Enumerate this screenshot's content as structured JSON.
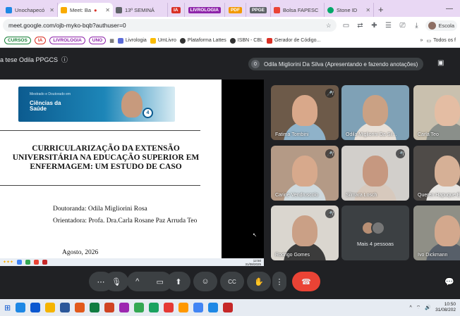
{
  "tabs": [
    {
      "label": "Unochapecó",
      "color": "#1e88e5",
      "icon": "uno-icon",
      "active": false
    },
    {
      "label": "Meet: Ba",
      "color": "#f9ab00",
      "icon": "meet-icon",
      "active": true
    },
    {
      "label": "13º SEMINÁ",
      "color": "#5f6368",
      "icon": "page-icon",
      "active": false
    }
  ],
  "tab_badges": [
    {
      "label": "IA",
      "color": "#d93025"
    },
    {
      "label": "LIVROLOGIA",
      "color": "#8e24aa"
    },
    {
      "label": "PDF",
      "color": "#f29900"
    },
    {
      "label": "PPGE",
      "color": "#5f6368"
    }
  ],
  "tab_bolsa": "Bolsa FAPESC",
  "tab_stone": "Stone ID",
  "window": {
    "minimize": "—",
    "maximize": "☐",
    "close": "✕",
    "newtab": "+"
  },
  "address": {
    "url": "meet.google.com/ojb-myko-bqb?authuser=0",
    "profile": "Escola"
  },
  "bookmarks": {
    "pills": [
      "CURSOS",
      "IA",
      "LIVROLOGIA",
      "UNO"
    ],
    "items": [
      "Livrologia",
      "UmLivro",
      "Plataforma Lattes",
      "ISBN - CBL",
      "Gerador de Código..."
    ],
    "more": "»",
    "folder": "Todos os f"
  },
  "meet": {
    "title": "a tese Odila PPGCS",
    "presenter": "Odila Migliorini Da Silva (Apresentando e fazendo anotações)",
    "presenter_count": "0"
  },
  "slide": {
    "banner_small": "Mestrado e Doutorado em",
    "banner_title": "Ciências da Saúde",
    "banner_badge": "4",
    "title_line1": "CURRICULARIZAÇÃO DA EXTENSÃO",
    "title_line2": "UNIVERSITÁRIA NA EDUCAÇÃO SUPERIOR EM",
    "title_line3": "ENFERMAGEM: UM ESTUDO DE CASO",
    "doutoranda": "Doutoranda: Odila Migliorini Rosa",
    "orientadora": "Orientadora: Profa. Dra.Carla Rosane Paz Arruda Teo",
    "date": "Agosto, 2026",
    "inner_time": "12:50",
    "inner_date": "31/08/2025"
  },
  "participants": [
    {
      "name": "Fatima Tombini",
      "bg": "#6d5a49",
      "skin": "#d9a88a",
      "shirt": "#8fb2c9",
      "muted": true
    },
    {
      "name": "Odila Migliorini Da Sil...",
      "bg": "#7fa1b6",
      "skin": "#caa184",
      "shirt": "#e7e0d8",
      "muted": false
    },
    {
      "name": "Carla Teo",
      "bg": "#c9c0ae",
      "skin": "#e4bda3",
      "shirt": "#8a8f8a",
      "muted": false
    },
    {
      "name": "Carine Vendruscolo",
      "bg": "#b49a86",
      "skin": "#d7a98c",
      "shirt": "#cfd9dd",
      "muted": true
    },
    {
      "name": "Silmara Losch",
      "bg": "#d2cfcb",
      "skin": "#c69880",
      "shirt": "#d7c9bd",
      "muted": true
    },
    {
      "name": "Queren Hapuque E",
      "bg": "#4f4b48",
      "skin": "#d6b096",
      "shirt": "#e7e5e2",
      "muted": false
    },
    {
      "name": "Rodrigo Gomes",
      "bg": "#dad6cf",
      "skin": "#caa086",
      "shirt": "#3b3b3b",
      "muted": true
    },
    {
      "name": "Ivo Dickmann",
      "bg": "#8f8f86",
      "skin": "#d3a88d",
      "shirt": "#575f69",
      "muted": false
    }
  ],
  "more_people": "Mais 4 pessoas",
  "controls": {
    "more": "⋯",
    "mic": "🎙",
    "caret": "^",
    "camera": "▭",
    "present": "⬆",
    "emoji": "☺",
    "captions": "CC",
    "hand": "✋",
    "options": "⋮",
    "hangup": "☎",
    "chat": "💬"
  },
  "taskbar": {
    "time": "10:50",
    "date": "31/08/202",
    "apps": [
      "#1e88e5",
      "#0b57d0",
      "#f5b400",
      "#2b579a",
      "#e25a1c",
      "#107c41",
      "#d04423",
      "#9c27b0",
      "#34a853",
      "#1aa260",
      "#e53935",
      "#ff9800",
      "#4285f4",
      "#1e88e5",
      "#c62828"
    ]
  }
}
